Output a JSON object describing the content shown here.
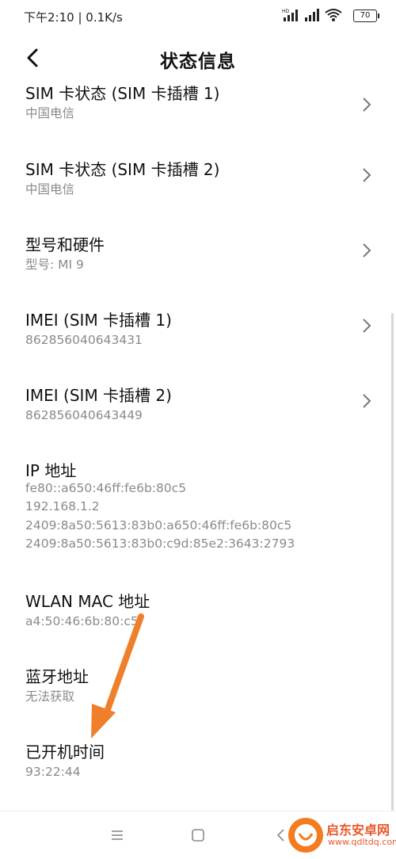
{
  "status_bar": {
    "left_text": "下午2:10 | 0.1K/s",
    "battery": "70"
  },
  "header": {
    "title": "状态信息"
  },
  "items": [
    {
      "title": "SIM 卡状态 (SIM 卡插槽 1)",
      "lines": [
        "中国电信"
      ],
      "has_chevron": true
    },
    {
      "title": "SIM 卡状态 (SIM 卡插槽 2)",
      "lines": [
        "中国电信"
      ],
      "has_chevron": true
    },
    {
      "title": "型号和硬件",
      "lines": [
        "型号: MI 9"
      ],
      "has_chevron": true
    },
    {
      "title": "IMEI (SIM 卡插槽 1)",
      "lines": [
        "862856040643431"
      ],
      "has_chevron": true
    },
    {
      "title": "IMEI (SIM 卡插槽 2)",
      "lines": [
        "862856040643449"
      ],
      "has_chevron": true
    },
    {
      "title": "IP 地址",
      "lines": [
        "fe80::a650:46ff:fe6b:80c5",
        "192.168.1.2",
        "2409:8a50:5613:83b0:a650:46ff:fe6b:80c5",
        "2409:8a50:5613:83b0:c9d:85e2:3643:2793"
      ],
      "has_chevron": false
    },
    {
      "title": "WLAN MAC 地址",
      "lines": [
        "a4:50:46:6b:80:c5"
      ],
      "has_chevron": false
    },
    {
      "title": "蓝牙地址",
      "lines": [
        "无法获取"
      ],
      "has_chevron": false
    },
    {
      "title": "已开机时间",
      "lines": [
        "93:22:44"
      ],
      "has_chevron": false
    }
  ],
  "watermark": {
    "brand": "启东安卓网",
    "url": "www.qdltdq.com"
  },
  "colors": {
    "arrow": "#f07f2b",
    "subtext": "#8a8a8a"
  }
}
